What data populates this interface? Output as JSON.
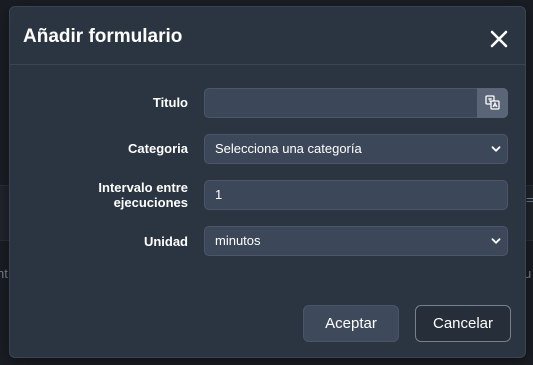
{
  "background": {
    "left_text": "nt",
    "right_text": "u",
    "edge_glyph": "="
  },
  "dialog": {
    "title": "Añadir formulario",
    "close_icon": "close-icon",
    "fields": {
      "titulo": {
        "label": "Titulo",
        "value": "",
        "addon_icon": "translate-icon"
      },
      "categoria": {
        "label": "Categoria",
        "selected": "Selecciona una categoría"
      },
      "intervalo": {
        "label": "Intervalo entre ejecuciones",
        "value": "1"
      },
      "unidad": {
        "label": "Unidad",
        "selected": "minutos"
      }
    },
    "buttons": {
      "accept": "Aceptar",
      "cancel": "Cancelar"
    }
  },
  "colors": {
    "dialog_bg": "#2b3542",
    "input_bg": "#3c4859",
    "addon_bg": "#5a6677",
    "text": "#ffffff"
  }
}
